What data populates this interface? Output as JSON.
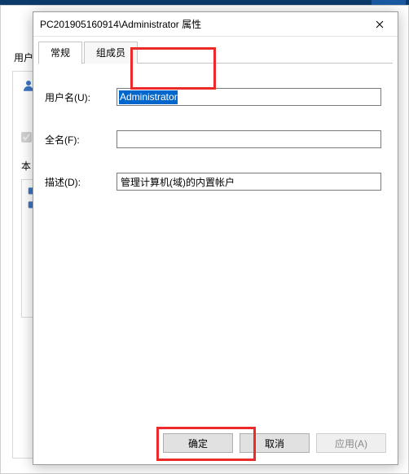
{
  "parent": {
    "label": "用户",
    "check_label": "",
    "label2": "本",
    "list_item_partial": ""
  },
  "dialog": {
    "title": "PC201905160914\\Administrator 属性",
    "tabs": [
      {
        "label": "常规",
        "active": true
      },
      {
        "label": "组成员",
        "active": false
      }
    ],
    "fields": {
      "username_label": "用户名(U):",
      "username_value": "Administrator",
      "fullname_label": "全名(F):",
      "fullname_value": "",
      "desc_label": "描述(D):",
      "desc_value": "管理计算机(域)的内置帐户"
    },
    "buttons": {
      "ok": "确定",
      "cancel": "取消",
      "apply": "应用(A)"
    }
  },
  "icons": {
    "close": "close-icon",
    "user": "user-icon"
  }
}
